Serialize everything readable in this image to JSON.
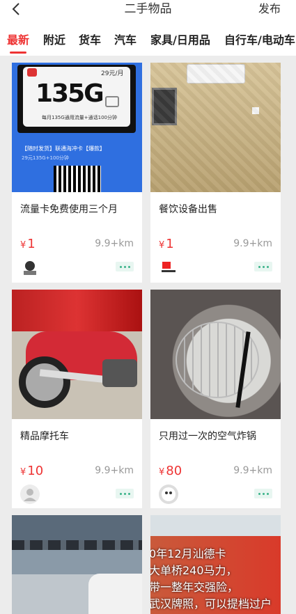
{
  "header": {
    "title": "二手物品",
    "publish": "发布"
  },
  "tabs": [
    "最新",
    "附近",
    "货车",
    "汽车",
    "家具/日用品",
    "自行车/电动车"
  ],
  "cards": [
    {
      "title": "流量卡免费使用三个月",
      "currency": "¥",
      "price": "1",
      "distance": "9.9+km",
      "promo": {
        "badge": "29元/月",
        "big": "135G",
        "sub": "每月135G通用流量+通话100分钟",
        "line1": "【随时发货】联通海冲卡【爆款】",
        "line2": "29元135G+100分钟"
      }
    },
    {
      "title": "餐饮设备出售",
      "currency": "¥",
      "price": "1",
      "distance": "9.9+km"
    },
    {
      "title": "精品摩托车",
      "currency": "¥",
      "price": "10",
      "distance": "9.9+km"
    },
    {
      "title": "只用过一次的空气炸锅",
      "currency": "¥",
      "price": "80",
      "distance": "9.9+km"
    }
  ],
  "truck_text": "0年12月汕德卡\n大单桥240马力，\n带一整年交强险，\n武汉牌照，可以提档过户"
}
